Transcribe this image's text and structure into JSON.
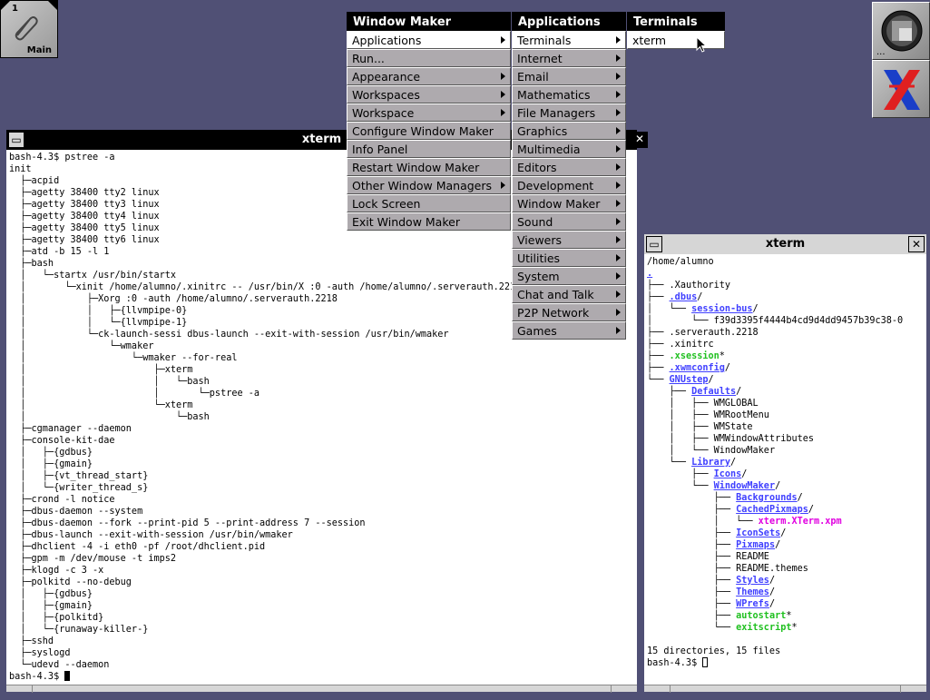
{
  "clip": {
    "workspace_number": "1",
    "workspace_name": "Main"
  },
  "dock": {
    "dots": "..."
  },
  "menus": {
    "window_maker": {
      "title": "Window Maker",
      "items": [
        {
          "label": "Applications",
          "submenu": true,
          "active": true
        },
        {
          "label": "Run...",
          "submenu": false
        },
        {
          "label": "Appearance",
          "submenu": true
        },
        {
          "label": "Workspaces",
          "submenu": true
        },
        {
          "label": "Workspace",
          "submenu": true
        },
        {
          "label": "Configure Window Maker",
          "submenu": false
        },
        {
          "label": "Info Panel",
          "submenu": false
        },
        {
          "label": "Restart Window Maker",
          "submenu": false
        },
        {
          "label": "Other Window Managers",
          "submenu": true
        },
        {
          "label": "Lock Screen",
          "submenu": false
        },
        {
          "label": "Exit Window Maker",
          "submenu": false
        }
      ]
    },
    "applications": {
      "title": "Applications",
      "items": [
        {
          "label": "Terminals",
          "active": true
        },
        {
          "label": "Internet"
        },
        {
          "label": "Email"
        },
        {
          "label": "Mathematics"
        },
        {
          "label": "File Managers"
        },
        {
          "label": "Graphics"
        },
        {
          "label": "Multimedia"
        },
        {
          "label": "Editors"
        },
        {
          "label": "Development"
        },
        {
          "label": "Window Maker"
        },
        {
          "label": "Sound"
        },
        {
          "label": "Viewers"
        },
        {
          "label": "Utilities"
        },
        {
          "label": "System"
        },
        {
          "label": "Chat and Talk"
        },
        {
          "label": "P2P Network"
        },
        {
          "label": "Games"
        }
      ]
    },
    "terminals": {
      "title": "Terminals",
      "items": [
        {
          "label": "xterm",
          "active": true
        }
      ]
    }
  },
  "xterm_main": {
    "title": "xterm",
    "lines": [
      "bash-4.3$ pstree -a",
      "init",
      "  ├─acpid",
      "  ├─agetty 38400 tty2 linux",
      "  ├─agetty 38400 tty3 linux",
      "  ├─agetty 38400 tty4 linux",
      "  ├─agetty 38400 tty5 linux",
      "  ├─agetty 38400 tty6 linux",
      "  ├─atd -b 15 -l 1",
      "  ├─bash",
      "  │   └─startx /usr/bin/startx",
      "  │       └─xinit /home/alumno/.xinitrc -- /usr/bin/X :0 -auth /home/alumno/.serverauth.2218",
      "  │           ├─Xorg :0 -auth /home/alumno/.serverauth.2218",
      "  │           │   ├─{llvmpipe-0}",
      "  │           │   └─{llvmpipe-1}",
      "  │           └─ck-launch-sessi dbus-launch --exit-with-session /usr/bin/wmaker",
      "  │               └─wmaker",
      "  │                   └─wmaker --for-real",
      "  │                       ├─xterm",
      "  │                       │   └─bash",
      "  │                       │       └─pstree -a",
      "  │                       └─xterm",
      "  │                           └─bash",
      "  ├─cgmanager --daemon",
      "  ├─console-kit-dae",
      "  │   ├─{gdbus}",
      "  │   ├─{gmain}",
      "  │   ├─{vt_thread_start}",
      "  │   └─{writer_thread_s}",
      "  ├─crond -l notice",
      "  ├─dbus-daemon --system",
      "  ├─dbus-daemon --fork --print-pid 5 --print-address 7 --session",
      "  ├─dbus-launch --exit-with-session /usr/bin/wmaker",
      "  ├─dhclient -4 -i eth0 -pf /root/dhclient.pid",
      "  ├─gpm -m /dev/mouse -t imps2",
      "  ├─klogd -c 3 -x",
      "  ├─polkitd --no-debug",
      "  │   ├─{gdbus}",
      "  │   ├─{gmain}",
      "  │   ├─{polkitd}",
      "  │   └─{runaway-killer-}",
      "  ├─sshd",
      "  ├─syslogd",
      "  └─udevd --daemon"
    ],
    "prompt": "bash-4.3$ "
  },
  "xterm_tree": {
    "title": "xterm",
    "cwd": "/home/alumno",
    "lines": [
      {
        "prefix": "",
        "name": ".",
        "kind": "dir",
        "suffix": ""
      },
      {
        "prefix": "├── ",
        "name": ".Xauthority",
        "kind": "file",
        "suffix": ""
      },
      {
        "prefix": "├── ",
        "name": ".dbus",
        "kind": "dir",
        "suffix": "/"
      },
      {
        "prefix": "│   └── ",
        "name": "session-bus",
        "kind": "dir",
        "suffix": "/"
      },
      {
        "prefix": "│       └── ",
        "name": "f39d3395f4444b4cd9d4dd9457b39c38-0",
        "kind": "file",
        "suffix": ""
      },
      {
        "prefix": "├── ",
        "name": ".serverauth.2218",
        "kind": "file",
        "suffix": ""
      },
      {
        "prefix": "├── ",
        "name": ".xinitrc",
        "kind": "file",
        "suffix": ""
      },
      {
        "prefix": "├── ",
        "name": ".xsession",
        "kind": "exe",
        "suffix": "*"
      },
      {
        "prefix": "├── ",
        "name": ".xwmconfig",
        "kind": "dir",
        "suffix": "/"
      },
      {
        "prefix": "└── ",
        "name": "GNUstep",
        "kind": "dir",
        "suffix": "/"
      },
      {
        "prefix": "    ├── ",
        "name": "Defaults",
        "kind": "dir",
        "suffix": "/"
      },
      {
        "prefix": "    │   ├── ",
        "name": "WMGLOBAL",
        "kind": "file",
        "suffix": ""
      },
      {
        "prefix": "    │   ├── ",
        "name": "WMRootMenu",
        "kind": "file",
        "suffix": ""
      },
      {
        "prefix": "    │   ├── ",
        "name": "WMState",
        "kind": "file",
        "suffix": ""
      },
      {
        "prefix": "    │   ├── ",
        "name": "WMWindowAttributes",
        "kind": "file",
        "suffix": ""
      },
      {
        "prefix": "    │   └── ",
        "name": "WindowMaker",
        "kind": "file",
        "suffix": ""
      },
      {
        "prefix": "    └── ",
        "name": "Library",
        "kind": "dir",
        "suffix": "/"
      },
      {
        "prefix": "        ├── ",
        "name": "Icons",
        "kind": "dir",
        "suffix": "/"
      },
      {
        "prefix": "        └── ",
        "name": "WindowMaker",
        "kind": "dir",
        "suffix": "/"
      },
      {
        "prefix": "            ├── ",
        "name": "Backgrounds",
        "kind": "dir",
        "suffix": "/"
      },
      {
        "prefix": "            ├── ",
        "name": "CachedPixmaps",
        "kind": "dir",
        "suffix": "/"
      },
      {
        "prefix": "            │   └── ",
        "name": "xterm.XTerm.xpm",
        "kind": "img",
        "suffix": ""
      },
      {
        "prefix": "            ├── ",
        "name": "IconSets",
        "kind": "dir",
        "suffix": "/"
      },
      {
        "prefix": "            ├── ",
        "name": "Pixmaps",
        "kind": "dir",
        "suffix": "/"
      },
      {
        "prefix": "            ├── ",
        "name": "README",
        "kind": "file",
        "suffix": ""
      },
      {
        "prefix": "            ├── ",
        "name": "README.themes",
        "kind": "file",
        "suffix": ""
      },
      {
        "prefix": "            ├── ",
        "name": "Styles",
        "kind": "dir",
        "suffix": "/"
      },
      {
        "prefix": "            ├── ",
        "name": "Themes",
        "kind": "dir",
        "suffix": "/"
      },
      {
        "prefix": "            ├── ",
        "name": "WPrefs",
        "kind": "dir",
        "suffix": "/"
      },
      {
        "prefix": "            ├── ",
        "name": "autostart",
        "kind": "exe",
        "suffix": "*"
      },
      {
        "prefix": "            └── ",
        "name": "exitscript",
        "kind": "exe",
        "suffix": "*"
      }
    ],
    "summary": "15 directories, 15 files",
    "prompt": "bash-4.3$ "
  },
  "colors": {
    "desktop": "#505075",
    "menu_bg": "#aeaaae",
    "dir": "#4040ff",
    "exe": "#20c020",
    "img": "#e000e0"
  }
}
